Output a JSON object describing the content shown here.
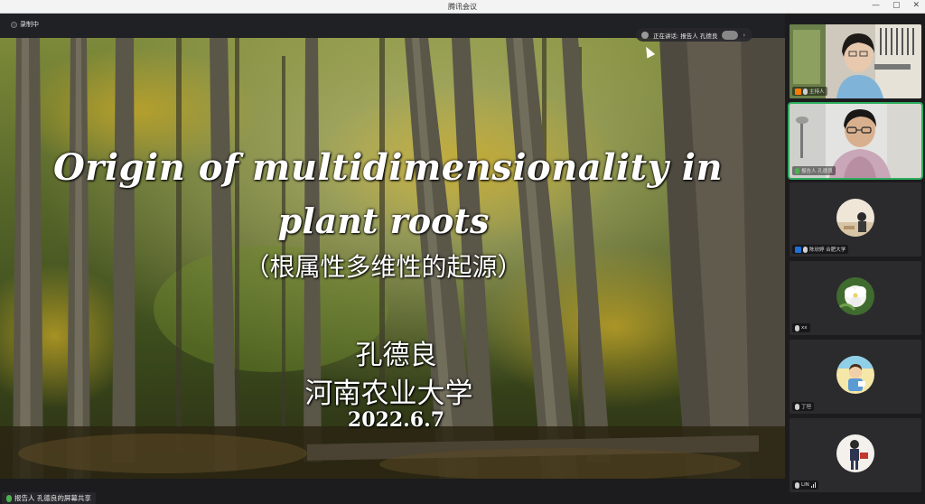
{
  "window": {
    "title": "腾讯会议",
    "controls": [
      "—",
      "▢",
      "✕"
    ]
  },
  "recording": {
    "label": "录制中"
  },
  "speaking": {
    "label": "正在讲话: 报告人 孔德良"
  },
  "slide": {
    "title_line1": "Origin of multidimensionality in",
    "title_line2": "plant roots",
    "subtitle": "（根属性多维性的起源）",
    "author": "孔德良",
    "university": "河南农业大学",
    "date": "2022.6.7"
  },
  "share_bar": {
    "label": "报告人 孔德良的屏幕共享"
  },
  "participants": [
    {
      "name": "主持人",
      "role": "host",
      "video": true
    },
    {
      "name": "报告人 孔德良",
      "role": "speaker",
      "video": true
    },
    {
      "name": "陈欣婷 合肥大学",
      "role": "member",
      "video": false
    },
    {
      "name": "xx",
      "role": "member",
      "video": false
    },
    {
      "name": "丁坦",
      "role": "member",
      "video": false
    },
    {
      "name": "LIN",
      "role": "member",
      "video": false
    }
  ],
  "colors": {
    "active_border": "#2fae5f",
    "host_badge": "#f57c00"
  }
}
